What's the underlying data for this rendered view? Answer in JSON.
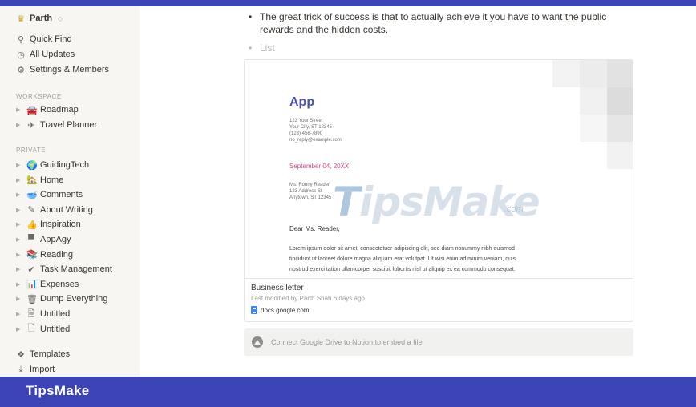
{
  "sidebar": {
    "workspace_name": "Parth",
    "workspace_caret": "◇",
    "top_items": [
      {
        "icon": "search-icon",
        "glyph": "⚲",
        "label": "Quick Find"
      },
      {
        "icon": "clock-icon",
        "glyph": "◷",
        "label": "All Updates"
      },
      {
        "icon": "gear-icon",
        "glyph": "⚙",
        "label": "Settings & Members"
      }
    ],
    "workspace_label": "WORKSPACE",
    "workspace_pages": [
      {
        "icon": "car-icon",
        "glyph": "🚘",
        "label": "Roadmap"
      },
      {
        "icon": "airplane-icon",
        "glyph": "✈",
        "label": "Travel Planner"
      }
    ],
    "private_label": "PRIVATE",
    "private_pages": [
      {
        "icon": "globe-icon",
        "glyph": "🌍",
        "label": "GuidingTech"
      },
      {
        "icon": "house-icon",
        "glyph": "🏡",
        "label": "Home"
      },
      {
        "icon": "bowl-icon",
        "glyph": "🥣",
        "label": "Comments"
      },
      {
        "icon": "pencil-icon",
        "glyph": "✎",
        "label": "About Writing"
      },
      {
        "icon": "hand-icon",
        "glyph": "👍",
        "label": "Inspiration"
      },
      {
        "icon": "laptop-icon",
        "glyph": "▀",
        "label": "AppAgy"
      },
      {
        "icon": "book-icon",
        "glyph": "📚",
        "label": "Reading"
      },
      {
        "icon": "check-icon",
        "glyph": "✔",
        "label": "Task Management"
      },
      {
        "icon": "chart-icon",
        "glyph": "📊",
        "label": "Expenses"
      },
      {
        "icon": "trash-icon",
        "glyph": "🗑",
        "label": "Dump Everything"
      },
      {
        "icon": "page-icon",
        "glyph": "🗎",
        "label": "Untitled"
      },
      {
        "icon": "page-outline-icon",
        "glyph": "🗋",
        "label": "Untitled"
      }
    ],
    "bottom_items": [
      {
        "icon": "templates-icon",
        "glyph": "❖",
        "label": "Templates"
      },
      {
        "icon": "import-icon",
        "glyph": "⤓",
        "label": "Import"
      }
    ]
  },
  "main": {
    "bullets": [
      "The great trick of success is that to actually achieve it you have to want the public rewards and the hidden costs."
    ],
    "placeholder_bullet": "List",
    "embed": {
      "doc": {
        "title": "App",
        "address_lines": [
          "123 Your Street",
          "Your City, ST 12345",
          "(123) 456-7890",
          "no_reply@example.com"
        ],
        "date": "September 04, 20XX",
        "recipient_lines": [
          "Ms. Ronny Reader",
          "123 Address St",
          "Anytown, ST 12345"
        ],
        "greeting": "Dear Ms. Reader,",
        "body_lines": [
          "Lorem ipsum dolor sit amet, consectetuer adipiscing elit, sed diam nonummy nibh euismod",
          "tincidunt ut laoreet dolore magna aliquam erat volutpat. Ut wisi enim ad minim veniam, quis",
          "nostrud exerci tation ullamcorper suscipit lobortis nisl ut aliquip ex ea commodo consequat."
        ]
      },
      "file_title": "Business letter",
      "file_meta": "Last modified by Parth Shah 6 days ago",
      "link_text": "docs.google.com"
    },
    "connect_text": "Connect Google Drive to Notion to embed a file",
    "watermark": {
      "lead": "T",
      "rest": "ipsMake",
      "suffix": ".com"
    }
  },
  "brand": {
    "label": "TipsMake"
  },
  "colors": {
    "accent": "#3a44b4",
    "doc_title": "#4b4fb0",
    "date": "#d5458a",
    "sidebar_bg": "#f7f6f3"
  }
}
